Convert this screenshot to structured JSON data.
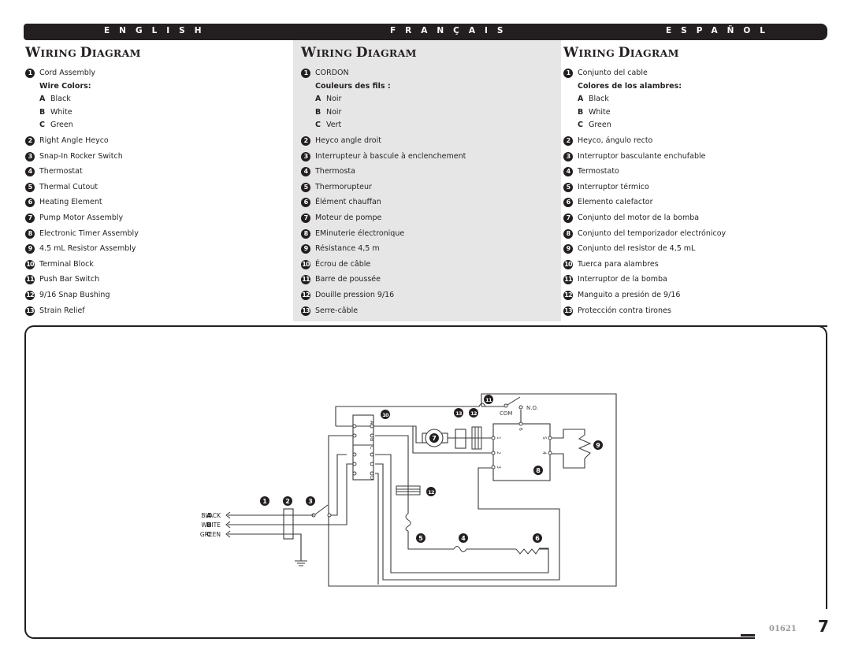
{
  "languages": [
    "ENGLISH",
    "FRANÇAIS",
    "ESPAÑOL"
  ],
  "sections": [
    {
      "lang": "en",
      "title_first": "W",
      "title_rest": "IRING ",
      "title_second": "D",
      "title_rest2": "IAGRAM",
      "item1": "Cord Assembly",
      "wire_colors_label": "Wire Colors:",
      "wires": [
        {
          "letter": "A",
          "color": "Black"
        },
        {
          "letter": "B",
          "color": "White"
        },
        {
          "letter": "C",
          "color": "Green"
        }
      ],
      "items": [
        {
          "n": "2",
          "label": "Right Angle Heyco"
        },
        {
          "n": "3",
          "label": "Snap-In Rocker Switch"
        },
        {
          "n": "4",
          "label": "Thermostat"
        },
        {
          "n": "5",
          "label": "Thermal Cutout"
        },
        {
          "n": "6",
          "label": "Heating Element"
        },
        {
          "n": "7",
          "label": "Pump Motor Assembly"
        },
        {
          "n": "8",
          "label": "Electronic Timer Assembly"
        },
        {
          "n": "9",
          "label": "4.5 mL Resistor Assembly"
        },
        {
          "n": "10",
          "label": "Terminal Block"
        },
        {
          "n": "11",
          "label": "Push Bar Switch"
        },
        {
          "n": "12",
          "label": "9/16 Snap Bushing"
        },
        {
          "n": "13",
          "label": "Strain Relief"
        }
      ]
    },
    {
      "lang": "fr",
      "title_first": "W",
      "title_rest": "IRING ",
      "title_second": "D",
      "title_rest2": "IAGRAM",
      "item1": "CORDON",
      "wire_colors_label": "Couleurs des fils :",
      "wires": [
        {
          "letter": "A",
          "color": "Noir"
        },
        {
          "letter": "B",
          "color": "Noir"
        },
        {
          "letter": "C",
          "color": "Vert"
        }
      ],
      "items": [
        {
          "n": "2",
          "label": "Heyco angle droit"
        },
        {
          "n": "3",
          "label": "Interrupteur à bascule à enclenchement"
        },
        {
          "n": "4",
          "label": "Thermosta"
        },
        {
          "n": "5",
          "label": "Thermorupteur"
        },
        {
          "n": "6",
          "label": "Élément chauffan"
        },
        {
          "n": "7",
          "label": "Moteur de pompe"
        },
        {
          "n": "8",
          "label": "EMinuterie électronique"
        },
        {
          "n": "9",
          "label": "Résistance 4,5 m"
        },
        {
          "n": "10",
          "label": "Écrou de câble"
        },
        {
          "n": "11",
          "label": "Barre de poussée"
        },
        {
          "n": "12",
          "label": "Douille pression 9/16"
        },
        {
          "n": "13",
          "label": "Serre-câble"
        }
      ]
    },
    {
      "lang": "es",
      "title_first": "W",
      "title_rest": "IRING ",
      "title_second": "D",
      "title_rest2": "IAGRAM",
      "item1": "Conjunto del cable",
      "wire_colors_label": "Colores de los alambres:",
      "wires": [
        {
          "letter": "A",
          "color": "Black"
        },
        {
          "letter": "B",
          "color": "White"
        },
        {
          "letter": "C",
          "color": "Green"
        }
      ],
      "items": [
        {
          "n": "2",
          "label": "Heyco, ángulo recto"
        },
        {
          "n": "3",
          "label": "Interruptor basculante enchufable"
        },
        {
          "n": "4",
          "label": "Termostato"
        },
        {
          "n": "5",
          "label": "Interruptor térmico"
        },
        {
          "n": "6",
          "label": "Elemento calefactor"
        },
        {
          "n": "7",
          "label": "Conjunto del motor de la bomba"
        },
        {
          "n": "8",
          "label": "Conjunto del temporizador electrónicoy"
        },
        {
          "n": "9",
          "label": "Conjunto del resistor de 4,5 mL"
        },
        {
          "n": "10",
          "label": "Tuerca para alambres"
        },
        {
          "n": "11",
          "label": "Interruptor de la bomba"
        },
        {
          "n": "12",
          "label": "Manguito a presión de 9/16"
        },
        {
          "n": "13",
          "label": "Protección contra tirones"
        }
      ]
    }
  ],
  "diagram": {
    "wire_labels": [
      {
        "letter": "A",
        "name": "BLACK"
      },
      {
        "letter": "B",
        "name": "WHITE"
      },
      {
        "letter": "C",
        "name": "GREEN"
      }
    ],
    "terminal_block_labels": [
      "A",
      "B",
      "C",
      "D"
    ],
    "timer_pins": [
      "1",
      "2",
      "3",
      "4",
      "5",
      "6"
    ],
    "switch_labels": {
      "com": "COM",
      "no": "N.O."
    },
    "callouts": [
      "1",
      "2",
      "3",
      "4",
      "5",
      "6",
      "7",
      "8",
      "9",
      "10",
      "11",
      "12",
      "12",
      "13"
    ]
  },
  "footer": {
    "doc_code": "01621",
    "page_number": "7"
  }
}
